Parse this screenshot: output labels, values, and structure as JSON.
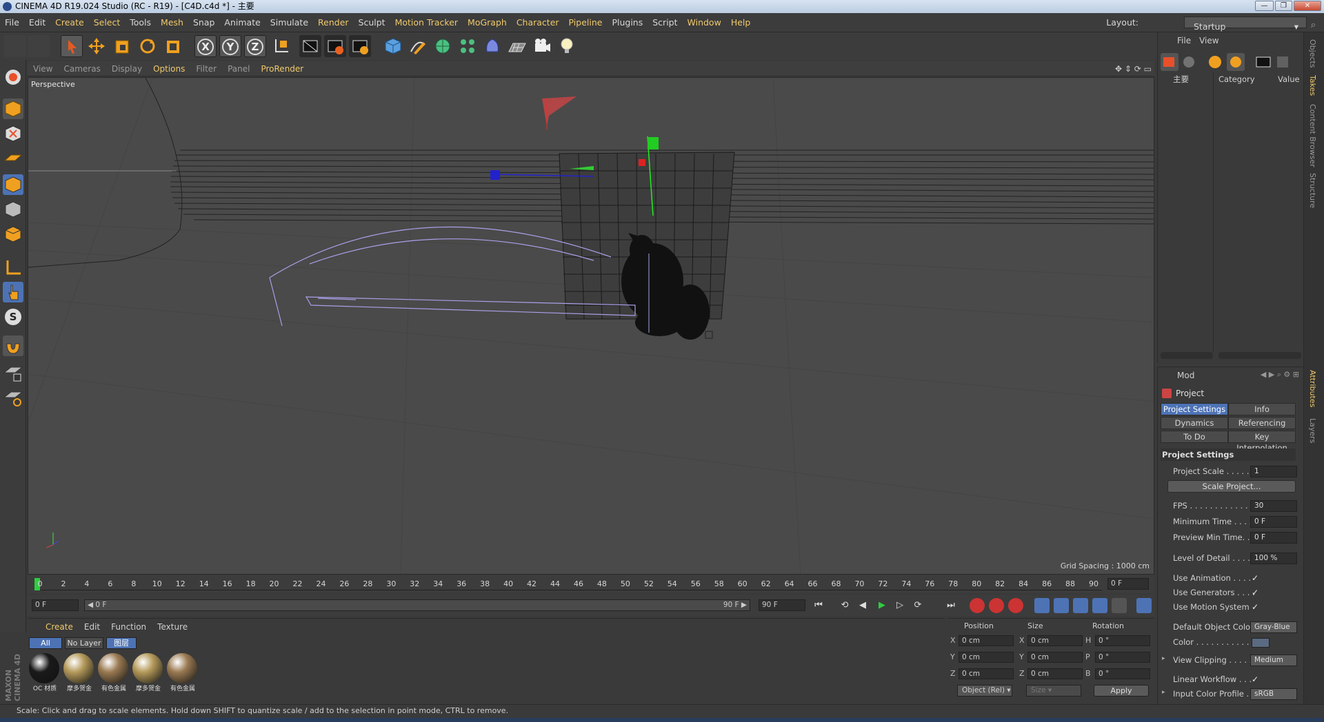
{
  "window": {
    "title": "CINEMA 4D R19.024 Studio (RC - R19) - [C4D.c4d *] - 主要",
    "buttons": [
      "—",
      "❐",
      "✕"
    ]
  },
  "menubar": {
    "items": [
      "File",
      "Edit",
      "Create",
      "Select",
      "Tools",
      "Mesh",
      "Snap",
      "Animate",
      "Simulate",
      "Render",
      "Sculpt",
      "Motion Tracker",
      "MoGraph",
      "Character",
      "Pipeline",
      "Plugins",
      "Script",
      "Window",
      "Help"
    ],
    "layout_label": "Layout:",
    "layout_value": "Startup"
  },
  "toolbar": {
    "icons": [
      "undo-icon",
      "redo-icon",
      "select-arrow-icon",
      "move-icon",
      "scale-icon",
      "rotate-icon",
      "recent-tool-icon",
      "x-axis-icon",
      "y-axis-icon",
      "z-axis-icon",
      "coordinate-system-icon",
      "render-view-icon",
      "render-picture-viewer-icon",
      "render-settings-icon",
      "cube-icon",
      "pen-icon",
      "subdivision-icon",
      "mograph-cloner-icon",
      "deformer-icon",
      "floor-icon",
      "camera-icon",
      "light-icon"
    ],
    "axis_labels": [
      "X",
      "Y",
      "Z"
    ]
  },
  "left_toolbar": {
    "icons": [
      "make-editable-icon",
      "model-mode-icon",
      "texture-mode-icon",
      "workplane-icon",
      "points-mode-icon",
      "edges-mode-icon",
      "polygons-mode-icon",
      "axis-mode-icon",
      "tweak-mode-icon",
      "solo-icon",
      "snap-icon",
      "workplane-lock-icon",
      "workplane-snap-icon"
    ],
    "solo_label": "S"
  },
  "viewport": {
    "menu": [
      "View",
      "Cameras",
      "Display",
      "Options",
      "Filter",
      "Panel",
      "ProRender"
    ],
    "active_menu": "Options",
    "label": "Perspective",
    "grid_spacing": "Grid Spacing : 1000 cm"
  },
  "timeline": {
    "ticks": [
      "0",
      "2",
      "4",
      "6",
      "8",
      "10",
      "12",
      "14",
      "16",
      "18",
      "20",
      "22",
      "24",
      "26",
      "28",
      "30",
      "32",
      "34",
      "36",
      "38",
      "40",
      "42",
      "44",
      "46",
      "48",
      "50",
      "52",
      "54",
      "56",
      "58",
      "60",
      "62",
      "64",
      "66",
      "68",
      "70",
      "72",
      "74",
      "76",
      "78",
      "80",
      "82",
      "84",
      "86",
      "88",
      "90"
    ],
    "current_frame": "0 F"
  },
  "playback": {
    "start_field": "0 F",
    "range_start": "◀ 0 F",
    "range_end": "90 F ▶",
    "end_field": "90 F",
    "controls": [
      "⏮",
      "⟲",
      "◀",
      "▶",
      "▷",
      "⟳",
      "⏭"
    ]
  },
  "material_manager": {
    "menu": [
      "Create",
      "Edit",
      "Function",
      "Texture"
    ],
    "tabs": [
      "All",
      "No Layer",
      "图层"
    ],
    "materials": [
      {
        "name": "OC 材质",
        "color": "#1a1a1a"
      },
      {
        "name": "摩多贺金",
        "color": "#b59a5a"
      },
      {
        "name": "有色金属",
        "color": "#9a7a52"
      },
      {
        "name": "摩多贺金",
        "color": "#b59a5a"
      },
      {
        "name": "有色金属",
        "color": "#9a7a52"
      }
    ],
    "brand": "MAXON CINEMA 4D"
  },
  "coordinates": {
    "headers": [
      "Position",
      "Size",
      "Rotation"
    ],
    "rows": [
      {
        "a": "X",
        "pos": "0 cm",
        "b": "X",
        "size": "0 cm",
        "c": "H",
        "rot": "0 °"
      },
      {
        "a": "Y",
        "pos": "0 cm",
        "b": "Y",
        "size": "0 cm",
        "c": "P",
        "rot": "0 °"
      },
      {
        "a": "Z",
        "pos": "0 cm",
        "b": "Z",
        "size": "0 cm",
        "c": "B",
        "rot": "0 °"
      }
    ],
    "mode": "Object (Rel)",
    "size_mode": "Size",
    "apply": "Apply"
  },
  "objects_panel": {
    "menu": [
      "File",
      "View"
    ],
    "columns": [
      "主要",
      "Category",
      "Value"
    ]
  },
  "attributes": {
    "mode": "Mod",
    "title": "Project",
    "tabs": [
      "Project Settings",
      "Info",
      "Dynamics",
      "Referencing",
      "To Do",
      "Key Interpolation"
    ],
    "section": "Project Settings",
    "rows": {
      "project_scale": {
        "label": "Project Scale . . . . . .",
        "value": "1"
      },
      "scale_project": "Scale Project...",
      "fps": {
        "label": "FPS . . . . . . . . . . . . . .",
        "value": "30"
      },
      "min_time": {
        "label": "Minimum Time . . . . .",
        "value": "0 F"
      },
      "preview_min": {
        "label": "Preview Min Time. . .",
        "value": "0 F"
      },
      "lod": {
        "label": "Level of Detail . . . . .",
        "value": "100 %"
      },
      "use_animation": {
        "label": "Use Animation . . . .",
        "value": "✓"
      },
      "use_generators": {
        "label": "Use Generators . . . .",
        "value": "✓"
      },
      "use_motion": {
        "label": "Use Motion System",
        "value": "✓"
      },
      "default_color": {
        "label": "Default Object Color",
        "value": "Gray-Blue"
      },
      "color": {
        "label": "Color . . . . . . . . . . .",
        "value": "▸"
      },
      "view_clipping": {
        "label": "View Clipping . . . . .",
        "value": "Medium"
      },
      "linear_workflow": {
        "label": "Linear Workflow . . .",
        "value": "✓"
      },
      "input_color_profile": {
        "label": "Input Color Profile . .",
        "value": "sRGB"
      }
    }
  },
  "right_tabs": [
    "Objects",
    "Takes",
    "Content Browser",
    "Structure",
    "Attributes",
    "Layers"
  ],
  "status": "Scale: Click and drag to scale elements. Hold down SHIFT to quantize scale / add to the selection in point mode, CTRL to remove.",
  "colors": {
    "accent": "#f0c96b",
    "selected_tab": "#4d73b5",
    "panel": "#3a3a3a",
    "viewport": "#4a4a4a"
  }
}
